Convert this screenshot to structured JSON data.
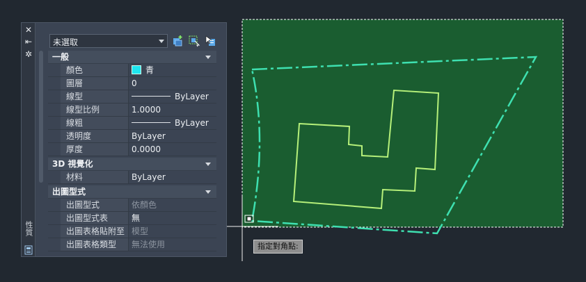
{
  "palette": {
    "title": "性質",
    "selection": "未選取",
    "toolbar": {
      "quick_select": "quick-select",
      "select_objects": "select-objects",
      "toggle_pickadd": "toggle-pickadd"
    },
    "sections": {
      "general": {
        "title": "一般",
        "rows": {
          "color": {
            "label": "顏色",
            "value": "青"
          },
          "layer": {
            "label": "圖層",
            "value": "0"
          },
          "linetype": {
            "label": "線型",
            "value": "ByLayer"
          },
          "ltscale": {
            "label": "線型比例",
            "value": "1.0000"
          },
          "lineweight": {
            "label": "線粗",
            "value": "ByLayer"
          },
          "transparency": {
            "label": "透明度",
            "value": "ByLayer"
          },
          "thickness": {
            "label": "厚度",
            "value": "0.0000"
          }
        }
      },
      "visual3d": {
        "title": "3D 視覺化",
        "rows": {
          "material": {
            "label": "材料",
            "value": "ByLayer"
          }
        }
      },
      "plotstyle": {
        "title": "出圖型式",
        "rows": {
          "plotstyle": {
            "label": "出圖型式",
            "value": "依顏色"
          },
          "plottable": {
            "label": "出圖型式表",
            "value": "無"
          },
          "attached": {
            "label": "出圖表格貼附至",
            "value": "模型"
          },
          "tabletype": {
            "label": "出圖表格類型",
            "value": "無法使用"
          }
        }
      }
    }
  },
  "canvas": {
    "tooltip": "指定對角點:",
    "selection_fill": "#1a5d30",
    "boundary_color": "#3ee0b0",
    "building_color": "#b6f07a",
    "color_swatch": "#1ee6f0"
  }
}
